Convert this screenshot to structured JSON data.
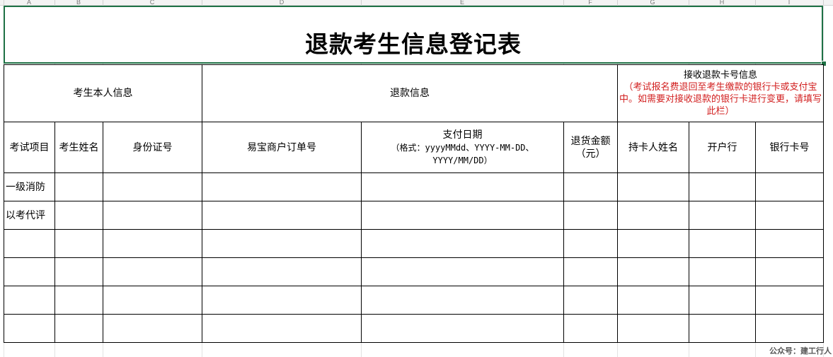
{
  "columns": [
    "A",
    "B",
    "C",
    "D",
    "E",
    "F",
    "G",
    "H",
    "I"
  ],
  "title": "退款考生信息登记表",
  "groups": {
    "personal": "考生本人信息",
    "refund": "退款信息",
    "card_title": "接收退款卡号信息",
    "card_note": "（考试报名费退回至考生缴款的银行卡或支付宝中。如需要对接收退款的银行卡进行变更，请填写此栏）"
  },
  "headers": {
    "exam_item": "考试项目",
    "name": "考生姓名",
    "id_number": "身份证号",
    "order_no": "易宝商户订单号",
    "pay_date": "支付日期",
    "pay_date_format": "（格式：yyyyMMdd、YYYY-MM-DD、YYYY/MM/DD）",
    "refund_amount": "退货金额（元）",
    "holder": "持卡人姓名",
    "bank": "开户行",
    "card_no": "银行卡号"
  },
  "rows": [
    {
      "exam_item": "一级消防"
    },
    {
      "exam_item": "以考代评"
    },
    {
      "exam_item": ""
    },
    {
      "exam_item": ""
    },
    {
      "exam_item": ""
    },
    {
      "exam_item": ""
    }
  ],
  "watermark": "公众号：建工行人",
  "colors": {
    "selection": "#1e7145",
    "note_red": "#d22020"
  }
}
